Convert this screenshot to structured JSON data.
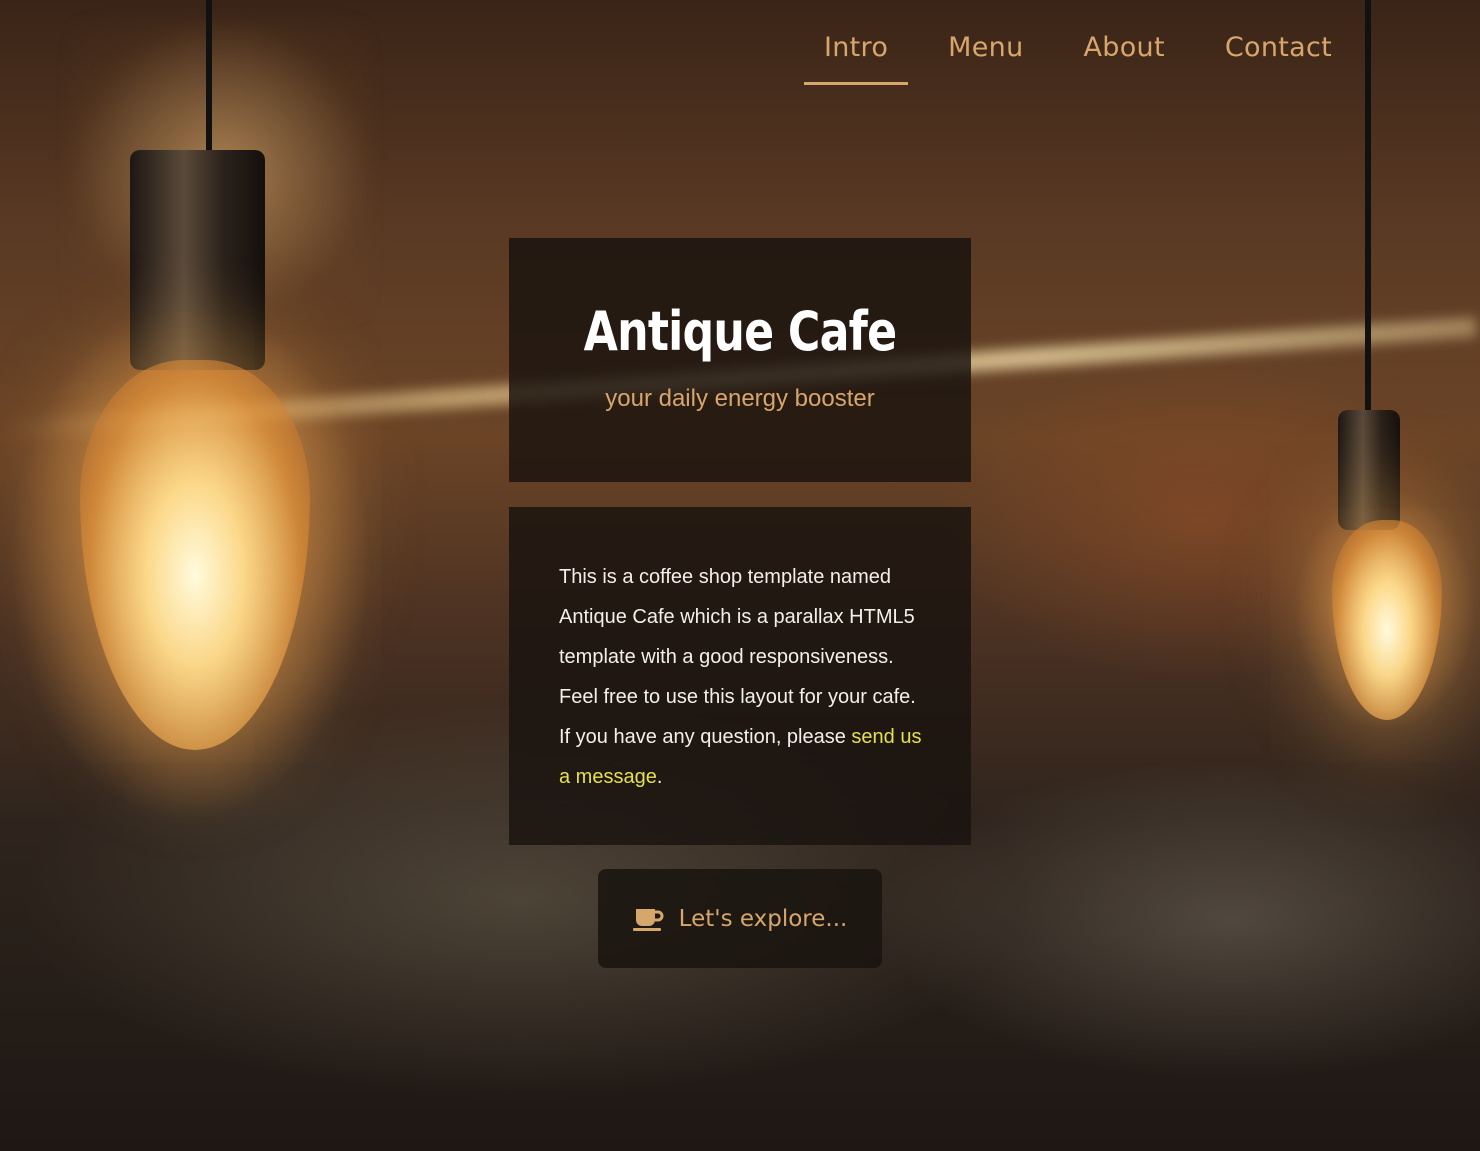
{
  "nav": {
    "items": [
      {
        "label": "Intro",
        "active": true
      },
      {
        "label": "Menu",
        "active": false
      },
      {
        "label": "About",
        "active": false
      },
      {
        "label": "Contact",
        "active": false
      }
    ]
  },
  "hero": {
    "title": "Antique Cafe",
    "tagline": "your daily energy booster"
  },
  "description": {
    "text_before_link": "This is a coffee shop template named Antique Cafe which is a parallax HTML5 template with a good responsiveness. Feel free to use this layout for your cafe. If you have any question, please ",
    "link_text": "send us a message",
    "text_after_link": "."
  },
  "explore_button": {
    "icon": "coffee-cup-icon",
    "label": "Let's explore..."
  },
  "colors": {
    "accent": "#d6a66c",
    "link": "#e5e04f",
    "panel": "#18120f",
    "title": "#ffffff"
  }
}
